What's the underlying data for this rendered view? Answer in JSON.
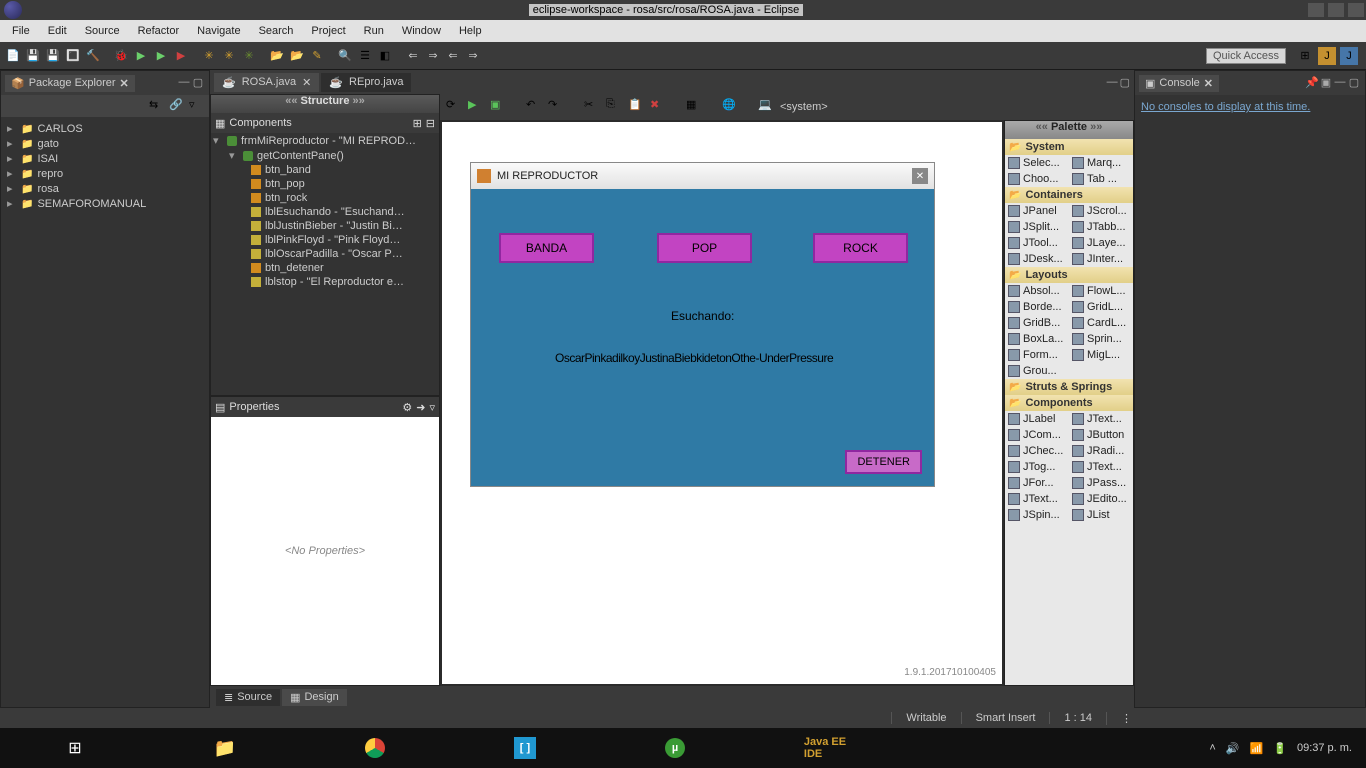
{
  "window": {
    "title": "eclipse-workspace - rosa/src/rosa/ROSA.java - Eclipse"
  },
  "menu": [
    "File",
    "Edit",
    "Source",
    "Refactor",
    "Navigate",
    "Search",
    "Project",
    "Run",
    "Window",
    "Help"
  ],
  "quick_access": "Quick Access",
  "package_explorer": {
    "title": "Package Explorer",
    "items": [
      "CARLOS",
      "gato",
      "ISAI",
      "repro",
      "rosa",
      "SEMAFOROMANUAL"
    ]
  },
  "editor_tabs": [
    {
      "label": "ROSA.java",
      "active": true
    },
    {
      "label": "REpro.java",
      "active": false
    }
  ],
  "structure": {
    "title": "Structure",
    "components_label": "Components",
    "root": "frmMiReproductor - \"MI REPROD…",
    "pane": "getContentPane()",
    "children": [
      {
        "type": "btn",
        "label": "btn_band"
      },
      {
        "type": "btn",
        "label": "btn_pop"
      },
      {
        "type": "btn",
        "label": "btn_rock"
      },
      {
        "type": "lbl",
        "label": "lblEsuchando - \"Esuchand…"
      },
      {
        "type": "lbl",
        "label": "lblJustinBieber - \"Justin Bi…"
      },
      {
        "type": "lbl",
        "label": "lblPinkFloyd - \"Pink Floyd…"
      },
      {
        "type": "lbl",
        "label": "lblOscarPadilla - \"Oscar P…"
      },
      {
        "type": "btn",
        "label": "btn_detener"
      },
      {
        "type": "lbl",
        "label": "lblstop - \"El Reproductor e…"
      }
    ]
  },
  "properties": {
    "title": "Properties",
    "empty": "<No Properties>"
  },
  "designer": {
    "system_label": "<system>",
    "frame_title": "MI REPRODUCTOR",
    "buttons": {
      "banda": "BANDA",
      "pop": "POP",
      "rock": "ROCK",
      "detener": "DETENER"
    },
    "labels": {
      "escuchando": "Esuchando:",
      "overlap": "OscarPinkadilkoyJustinaBiebkidetonOthe-UnderPressure"
    },
    "version": "1.9.1.201710100405"
  },
  "palette": {
    "title": "Palette",
    "categories": [
      {
        "name": "System",
        "items": [
          "Selec...",
          "Marq...",
          "Choo...",
          "Tab ..."
        ]
      },
      {
        "name": "Containers",
        "items": [
          "JPanel",
          "JScrol...",
          "JSplit...",
          "JTabb...",
          "JTool...",
          "JLaye...",
          "JDesk...",
          "JInter..."
        ]
      },
      {
        "name": "Layouts",
        "items": [
          "Absol...",
          "FlowL...",
          "Borde...",
          "GridL...",
          "GridB...",
          "CardL...",
          "BoxLa...",
          "Sprin...",
          "Form...",
          "MigL...",
          "Grou..."
        ]
      },
      {
        "name": "Struts & Springs",
        "items": []
      },
      {
        "name": "Components",
        "items": [
          "JLabel",
          "JText...",
          "JCom...",
          "JButton",
          "JChec...",
          "JRadi...",
          "JTog...",
          "JText...",
          "JFor...",
          "JPass...",
          "JText...",
          "JEdito...",
          "JSpin...",
          "JList"
        ]
      }
    ]
  },
  "bottom_tabs": {
    "source": "Source",
    "design": "Design"
  },
  "console": {
    "title": "Console",
    "message": "No consoles to display at this time."
  },
  "status": {
    "writable": "Writable",
    "insert": "Smart Insert",
    "pos": "1 : 14"
  },
  "taskbar": {
    "clock": "09:37 p. m."
  }
}
